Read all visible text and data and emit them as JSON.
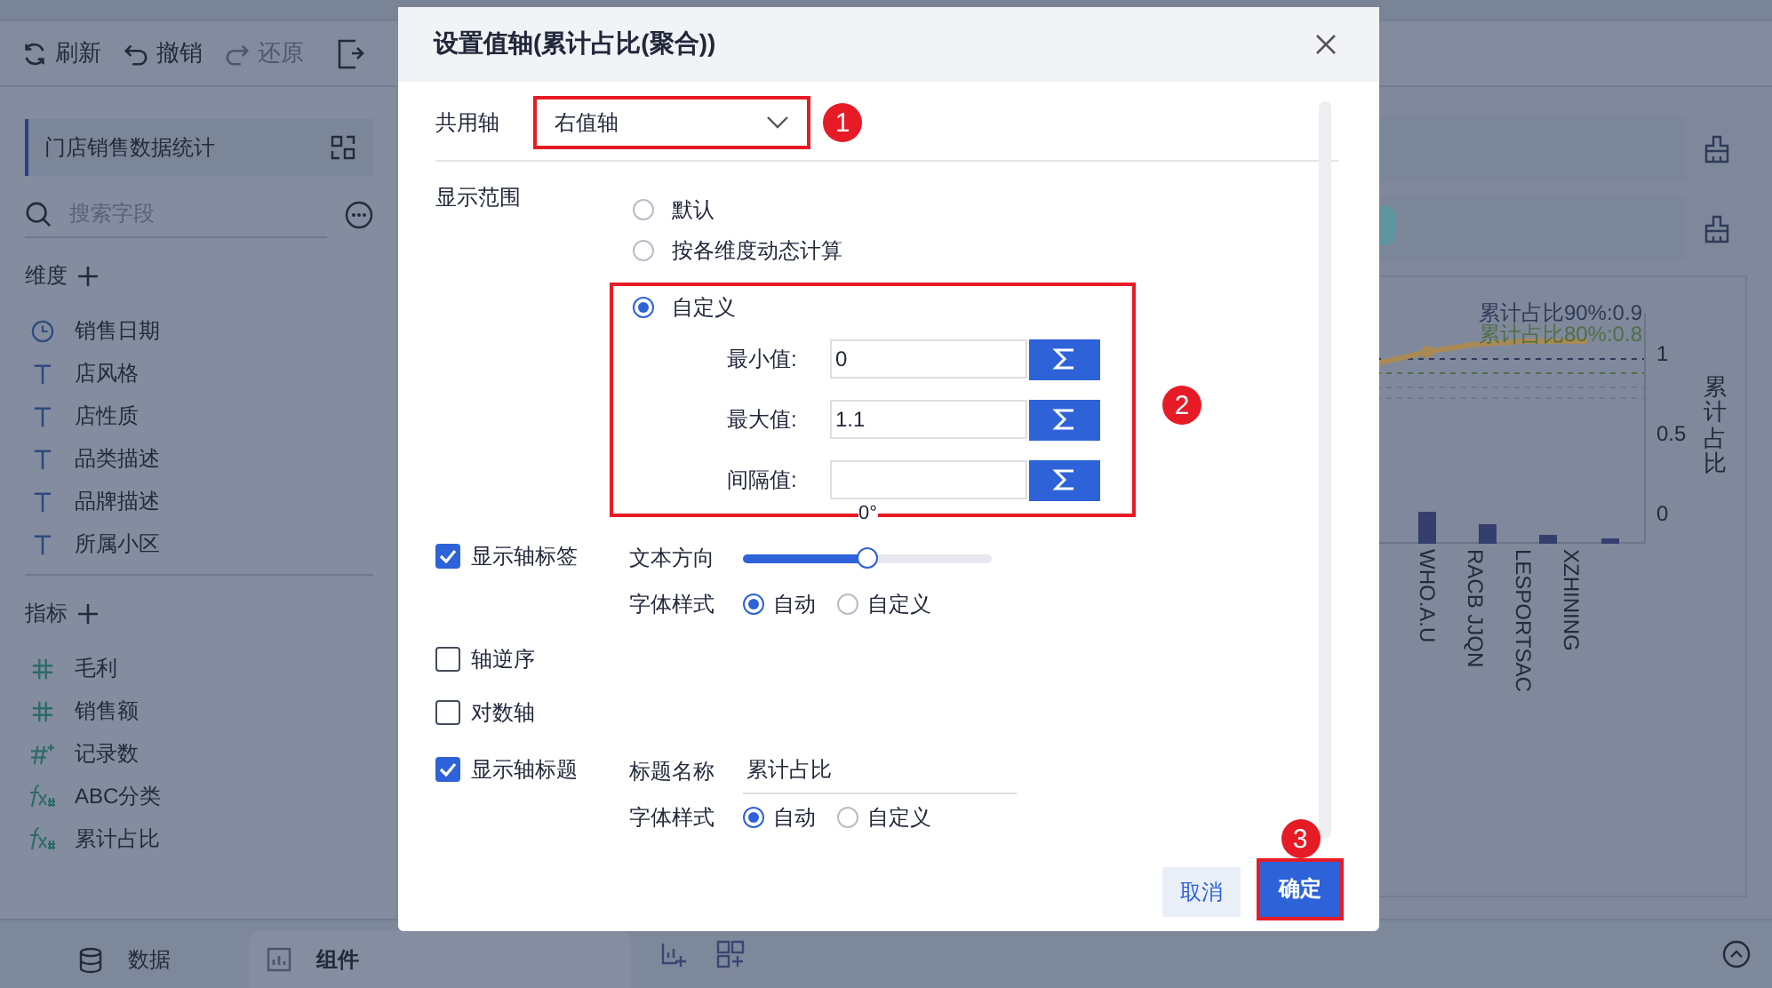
{
  "toolbar": [
    {
      "label": "刷新",
      "disabled": false
    },
    {
      "label": "撤销",
      "disabled": false
    },
    {
      "label": "还原",
      "disabled": true
    }
  ],
  "sidebar": {
    "dataset": "门店销售数据统计",
    "search": {
      "placeholder": "搜索字段"
    },
    "dimensions": {
      "title": "维度",
      "items": [
        {
          "kind": "date",
          "label": "销售日期"
        },
        {
          "kind": "text",
          "label": "店风格"
        },
        {
          "kind": "text",
          "label": "店性质"
        },
        {
          "kind": "text",
          "label": "品类描述"
        },
        {
          "kind": "text",
          "label": "品牌描述"
        },
        {
          "kind": "text",
          "label": "所属小区"
        }
      ]
    },
    "measures": {
      "title": "指标",
      "items": [
        {
          "kind": "number",
          "label": "毛利"
        },
        {
          "kind": "number",
          "label": "销售额"
        },
        {
          "kind": "count",
          "label": "记录数"
        },
        {
          "kind": "calc",
          "label": "ABC分类"
        },
        {
          "kind": "calc",
          "label": "累计占比"
        }
      ]
    }
  },
  "chart": {
    "reference_lines": [
      {
        "label": "累计占比90%:0.9",
        "color": "#2e3a58"
      },
      {
        "label": "累计占比80%:0.8",
        "color": "#4f6f47"
      }
    ],
    "y_ticks": [
      "1",
      "0.5",
      "0"
    ],
    "axis_title": "累计占比",
    "categories": [
      "WHO.A.U",
      "RACB JJQN",
      "LESPORTSAC",
      "XZHINING"
    ]
  },
  "bottom_tabs": [
    {
      "label": "数据",
      "selected": false
    },
    {
      "label": "组件",
      "selected": true
    }
  ],
  "dialog": {
    "title": "设置值轴(累计占比(聚合))",
    "shared_axis": {
      "label": "共用轴",
      "value": "右值轴"
    },
    "range": {
      "label": "显示范围",
      "options": [
        {
          "label": "默认",
          "selected": false
        },
        {
          "label": "按各维度动态计算",
          "selected": false
        },
        {
          "label": "自定义",
          "selected": true
        }
      ],
      "fields": [
        {
          "label": "最小值:",
          "value": "0"
        },
        {
          "label": "最大值:",
          "value": "1.1"
        },
        {
          "label": "间隔值:"
        }
      ],
      "angle": "0°"
    },
    "axis_labels": {
      "label": "显示轴标签",
      "checked": true,
      "direction_label": "文本方向",
      "level": 0.5,
      "font_label": "字体样式",
      "font_options": [
        {
          "label": "自动",
          "selected": true
        },
        {
          "label": "自定义",
          "selected": false
        }
      ]
    },
    "reverse": {
      "label": "轴逆序",
      "checked": false
    },
    "log": {
      "label": "对数轴",
      "checked": false
    },
    "axis_title": {
      "label": "显示轴标题",
      "checked": true,
      "name_label": "标题名称",
      "name_value": "累计占比",
      "font_label": "字体样式",
      "font_options": [
        {
          "label": "自动",
          "selected": true
        },
        {
          "label": "自定义",
          "selected": false
        }
      ]
    },
    "cancel": "取消",
    "ok": "确定"
  },
  "steps": [
    "1",
    "2",
    "3"
  ]
}
